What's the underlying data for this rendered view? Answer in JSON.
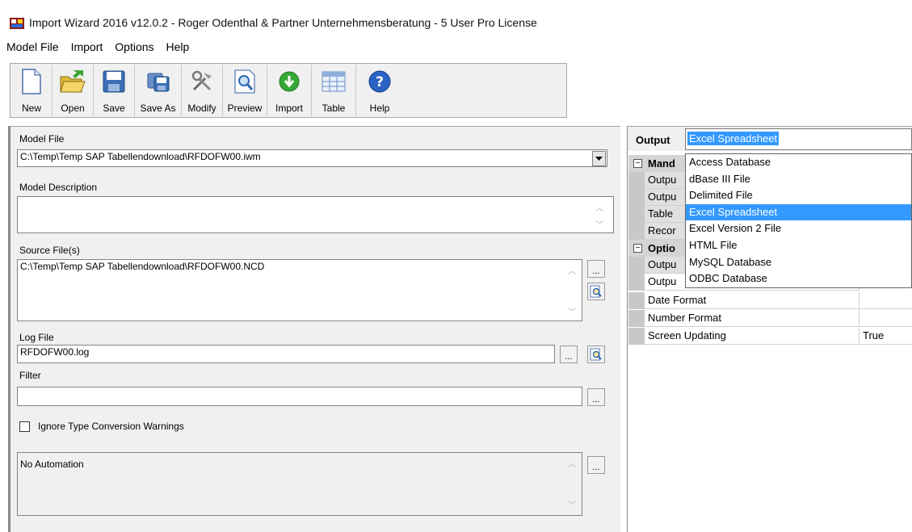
{
  "window": {
    "title": "Import Wizard 2016 v12.0.2 - Roger Odenthal & Partner Unternehmensberatung - 5 User Pro License"
  },
  "menu": [
    "Model File",
    "Import",
    "Options",
    "Help"
  ],
  "toolbar": [
    {
      "label": "New",
      "icon": "new-file-icon"
    },
    {
      "label": "Open",
      "icon": "open-folder-icon"
    },
    {
      "label": "Save",
      "icon": "floppy-disk-icon"
    },
    {
      "label": "Save As",
      "icon": "save-as-icon"
    },
    {
      "label": "Modify",
      "icon": "tools-icon"
    },
    {
      "label": "Preview",
      "icon": "magnifier-icon"
    },
    {
      "label": "Import",
      "icon": "green-download-icon"
    },
    {
      "label": "Table",
      "icon": "table-icon"
    },
    {
      "label": "Help",
      "icon": "help-icon"
    }
  ],
  "form": {
    "model_file_label": "Model File",
    "model_file_value": "C:\\Temp\\Temp SAP Tabellendownload\\RFDOFW00.iwm",
    "model_description_label": "Model Description",
    "model_description_value": "",
    "source_files_label": "Source File(s)",
    "source_files_value": "C:\\Temp\\Temp SAP Tabellendownload\\RFDOFW00.NCD",
    "log_file_label": "Log File",
    "log_file_value": "RFDOFW00.log",
    "filter_label": "Filter",
    "filter_value": "",
    "ignore_warnings_label": "Ignore Type Conversion Warnings",
    "ignore_warnings_checked": false,
    "automation_value": "No Automation",
    "dots": "..."
  },
  "properties": {
    "output_label": "Output",
    "output_selected": "Excel Spreadsheet",
    "sections": [
      {
        "name": "Mand",
        "expander": "⊟"
      },
      {
        "name": "Optio",
        "expander": "⊟"
      }
    ],
    "mandatory_rows": [
      "Outpu",
      "Outpu",
      "Table",
      "Recor"
    ],
    "optional_rows": [
      {
        "name": "Outpu",
        "value": ""
      },
      {
        "name": "Date Format",
        "value": ""
      },
      {
        "name": "Number Format",
        "value": ""
      },
      {
        "name": "Screen Updating",
        "value": "True"
      }
    ]
  },
  "dropdown": {
    "items": [
      "Access Database",
      "dBase III File",
      "Delimited File",
      "Excel Spreadsheet",
      "Excel Version 2 File",
      "HTML File",
      "MySQL Database",
      "ODBC Database"
    ],
    "selected_index": 3
  },
  "colors": {
    "selection": "#3399ff",
    "panel": "#f0f0f0",
    "section": "#d4d4d4"
  }
}
